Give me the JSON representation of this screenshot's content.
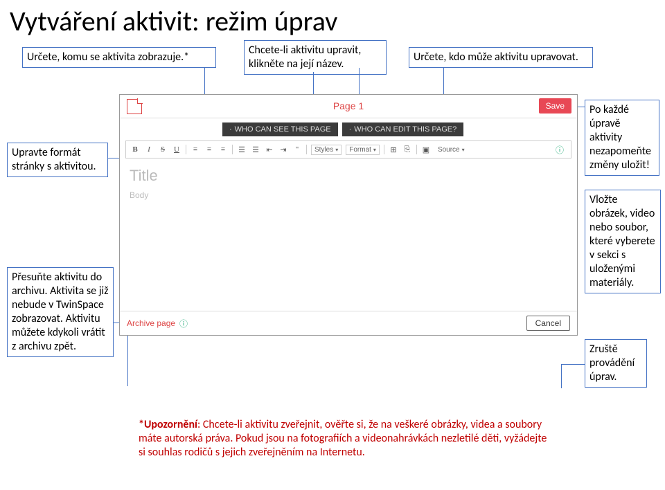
{
  "heading": "Vytváření aktivit: režim úprav",
  "callouts": {
    "c1": "Určete, komu se aktivita zobrazuje.*",
    "c2": "Chcete-li aktivitu upravit, klikněte na její název.",
    "c3": "Určete, kdo může aktivitu upravovat.",
    "c4": "Upravte formát stránky s aktivitou.",
    "c5": "Přesuňte aktivitu do archivu. Aktivita se již nebude v TwinSpace zobrazovat. Aktivitu můžete kdykoli vrátit z archivu zpět.",
    "c6": "Po každé úpravě aktivity nezapomeňte změny uložit!",
    "c7": "Vložte obrázek, video nebo soubor, které vyberete v sekci s uloženými materiály.",
    "c8": "Zruště provádění úprav."
  },
  "editor": {
    "page_title": "Page 1",
    "save": "Save",
    "tab_see": "WHO CAN SEE THIS PAGE",
    "tab_edit": "WHO CAN EDIT THIS PAGE?",
    "toolbar": {
      "B": "B",
      "I": "I",
      "S": "S",
      "U": "U",
      "styles": "Styles",
      "format": "Format",
      "source": "Source"
    },
    "title_placeholder": "Title",
    "body_placeholder": "Body",
    "archive": "Archive page",
    "cancel": "Cancel"
  },
  "warning": {
    "label": "*Upozornění",
    "body": ": Chcete-li aktivitu zveřejnit, ověřte si, že na veškeré obrázky, videa a soubory máte autorská práva. Pokud jsou na fotografiích a videonahrávkách nezletilé děti, vyžádejte si souhlas rodičů s jejich zveřejněním na Internetu."
  }
}
